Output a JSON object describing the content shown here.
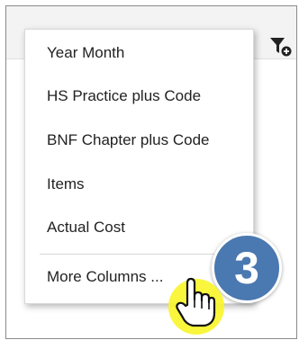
{
  "menu": {
    "items": [
      {
        "label": "Year Month"
      },
      {
        "label": "HS Practice plus Code"
      },
      {
        "label": "BNF Chapter plus Code"
      },
      {
        "label": "Items"
      },
      {
        "label": "Actual Cost"
      },
      {
        "label": "More Columns ..."
      }
    ]
  },
  "annotation": {
    "step_number": "3",
    "badge_color": "#4a78b0",
    "highlight_color": "#f8f52c"
  },
  "icons": {
    "filter": "filter-add-icon",
    "cursor": "hand-pointer-icon"
  }
}
